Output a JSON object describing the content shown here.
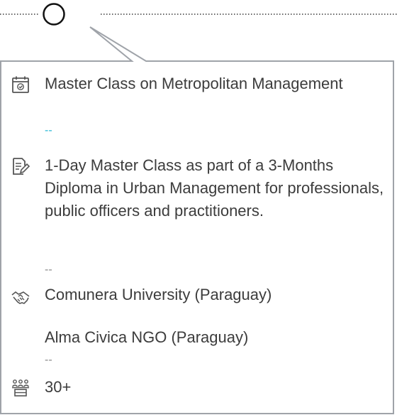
{
  "event": {
    "title": "Master Class on Metropolitan Management",
    "separator_1": "--",
    "description": "1-Day Master Class as part of a 3-Months Diploma in Urban Management for professionals, public officers and practitioners.",
    "separator_2": "--",
    "partners": [
      "Comunera University (Paraguay)",
      "Alma Civica NGO (Paraguay)"
    ],
    "separator_3": "--",
    "attendees": "30+"
  },
  "icons": {
    "title": "calendar-icon",
    "description": "document-pen-icon",
    "partners": "handshake-icon",
    "attendees": "audience-icon"
  },
  "colors": {
    "border": "#9fa3a9",
    "text": "#3c3c3c",
    "accent_separator": "#28b7d6",
    "icon": "#555555"
  }
}
